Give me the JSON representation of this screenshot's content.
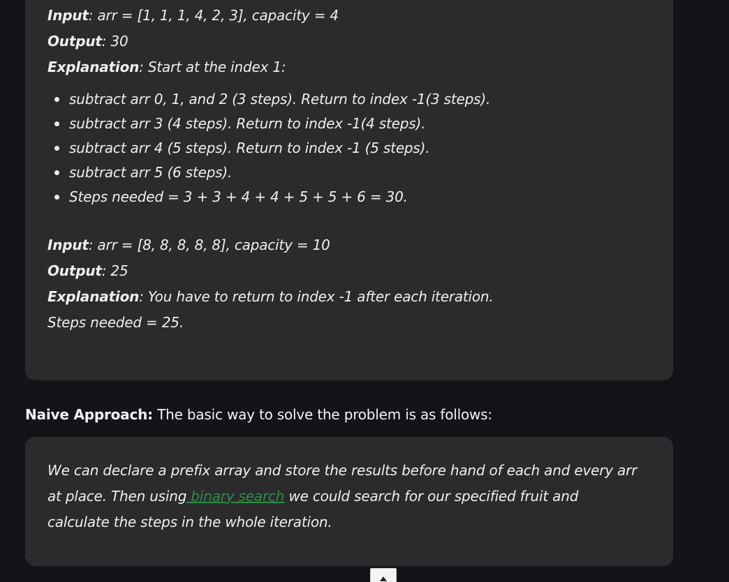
{
  "example1": {
    "input_label": "Input",
    "input_value": ": arr = [1, 1, 1, 4, 2, 3], capacity = 4",
    "output_label": "Output",
    "output_value": ": 30",
    "explanation_label": "Explanation",
    "explanation_value": ": Start at the index 1:",
    "steps": [
      "subtract arr 0, 1, and 2 (3 steps). Return to index -1(3 steps).",
      "subtract arr 3 (4 steps). Return to index -1(4 steps).",
      "subtract arr 4 (5 steps). Return to index -1 (5 steps).",
      "subtract arr 5 (6 steps).",
      "Steps needed = 3 + 3 + 4 + 4 + 5 + 5 + 6 = 30."
    ]
  },
  "example2": {
    "input_label": "Input",
    "input_value": ": arr = [8, 8, 8, 8, 8], capacity = 10",
    "output_label": "Output",
    "output_value": ": 25",
    "explanation_label": "Explanation",
    "explanation_value": ": You have to return to index -1 after each iteration.",
    "steps_line": "Steps needed = 25."
  },
  "naive": {
    "heading_bold": "Naive Approach:",
    "heading_text": " The basic way to solve the problem is as follows:",
    "line1": "We can declare a prefix array and store the results before hand of each and every arr",
    "line2_before": "at place. Then using",
    "link_text": " binary search",
    "line2_after": " we could search for our specified fruit and",
    "line3": "calculate the steps in the whole iteration."
  },
  "colors": {
    "background": "#131417",
    "box": "#2b2b2d",
    "link": "#2f8d46"
  },
  "icons": {
    "scroll_top": "caret-up-icon"
  }
}
